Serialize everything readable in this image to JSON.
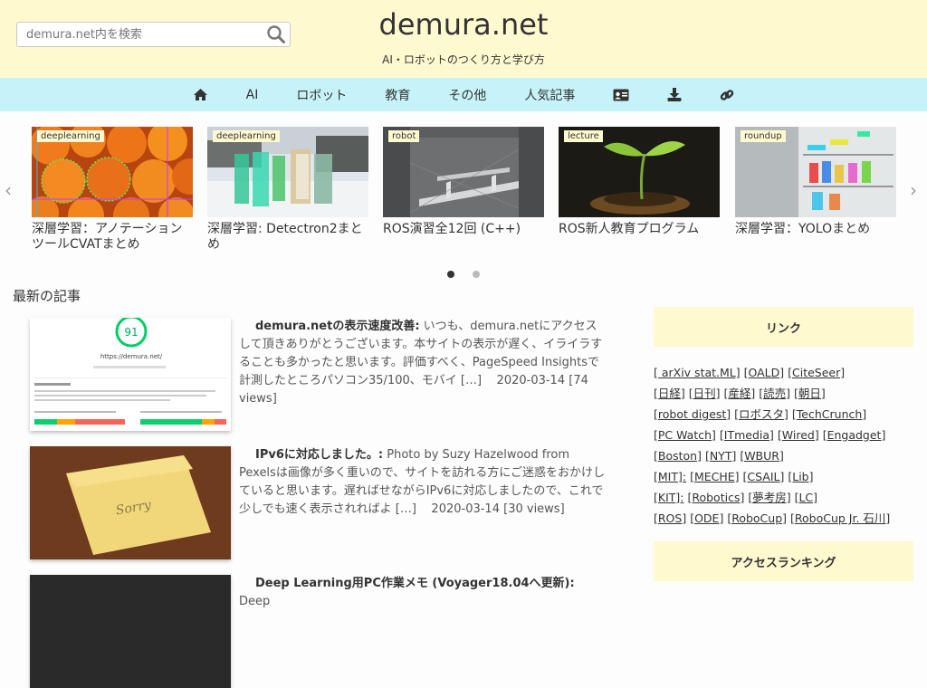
{
  "search": {
    "placeholder": "demura.net内を検索"
  },
  "site": {
    "title": "demura.net",
    "tagline": "AI・ロボットのつくり方と学び方"
  },
  "nav": {
    "items": [
      "AI",
      "ロボット",
      "教育",
      "その他",
      "人気記事"
    ],
    "icons": [
      "home-icon",
      "id-card-icon",
      "download-icon",
      "link-icon"
    ]
  },
  "slider": {
    "slides": [
      {
        "tag": "deeplearning",
        "title": "深層学習：アノテーションツールCVATまとめ"
      },
      {
        "tag": "deeplearning",
        "title": "深層学習: Detectron2まとめ"
      },
      {
        "tag": "robot",
        "title": "ROS演習全12回 (C++)"
      },
      {
        "tag": "lecture",
        "title": "ROS新人教育プログラム"
      },
      {
        "tag": "roundup",
        "title": "深層学習：YOLOまとめ"
      }
    ],
    "prev": "‹",
    "next": "›",
    "active_dot": 1,
    "dot_count": 2
  },
  "latest": {
    "heading": "最新の記事",
    "posts": [
      {
        "title": "demura.netの表示速度改善:",
        "excerpt": "いつも、demura.netにアクセスして頂きありがとうございます。本サイトの表示が遅く、イライラすることも多かったと思います。評価すべく、PageSpeed Insightsで計測したところパソコン35/100、モバイ […]",
        "date": "2020-03-14",
        "views": "[74 views]",
        "score": "91",
        "site": "https://demura.net/"
      },
      {
        "title": "IPv6に対応しました。:",
        "excerpt": "Photo by Suzy Hazelwood from Pexelsは画像が多く重いので、サイトを訪れる方にご迷惑をおかけしていると思います。遅ればせながらIPv6に対応しましたので、これで少しでも速く表示されればよ […]",
        "date": "2020-03-14",
        "views": "[30 views]",
        "note": "Sorry"
      },
      {
        "title": "Deep Learning用PC作業メモ (Voyager18.04へ更新):",
        "excerpt": "Deep"
      }
    ]
  },
  "sidebar": {
    "links_heading": "リンク",
    "links": [
      [
        "[ arXiv stat.ML]",
        "[OALD]",
        "[CiteSeer]"
      ],
      [
        "[日経]",
        "[日刊]",
        "[産経]",
        "[読売]",
        "[朝日]"
      ],
      [
        "[robot digest]",
        "[ロボスタ]",
        "[TechCrunch]"
      ],
      [
        "[PC Watch]",
        "[ITmedia]",
        "[Wired]",
        "[Engadget]"
      ],
      [
        "[Boston]",
        "[NYT]",
        "[WBUR]"
      ],
      [
        "[MIT]:",
        "[MECHE]",
        "[CSAIL]",
        "[Lib]"
      ],
      [
        "[KIT]:",
        "[Robotics]",
        "[夢考房]",
        "[LC]"
      ],
      [
        "[ROS]",
        "[ODE]",
        "[RoboCup]",
        "[RoboCup Jr. 石川]"
      ]
    ],
    "ranking_heading": "アクセスランキング"
  },
  "colors": {
    "header_bg": "#fff9d0",
    "nav_bg": "#c6f3f9",
    "tag_bg": "#fff9d0"
  }
}
